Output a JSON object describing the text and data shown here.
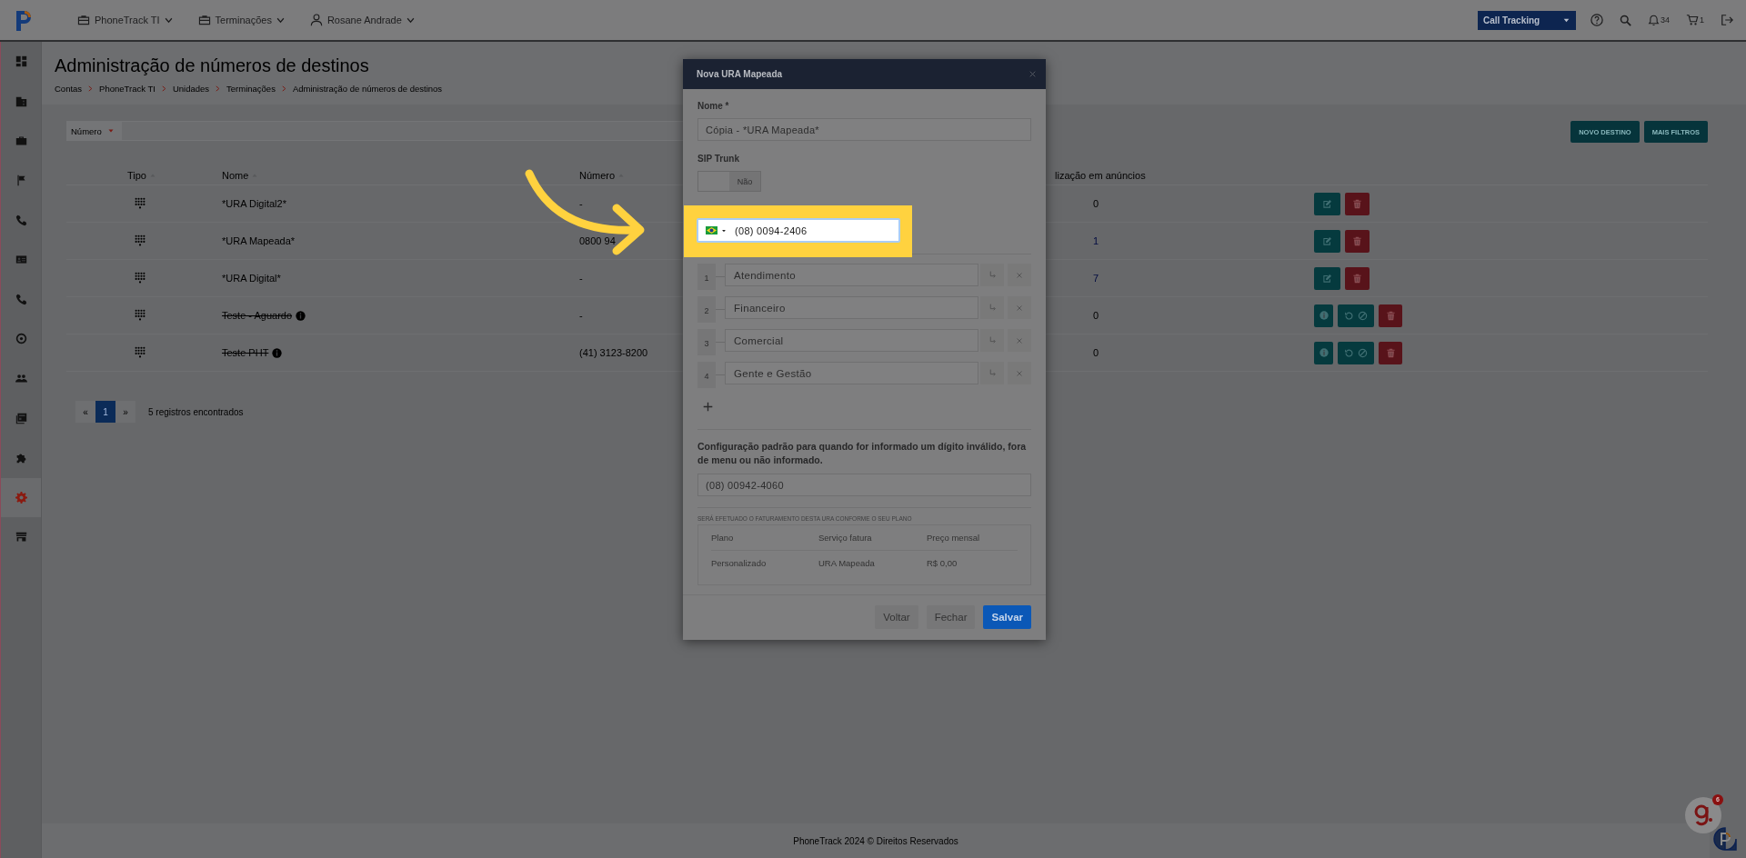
{
  "topbar": {
    "menus": [
      {
        "label": "PhoneTrack TI"
      },
      {
        "label": "Terminações"
      },
      {
        "label": "Rosane Andrade"
      }
    ],
    "product_select": "Call Tracking",
    "notification_count": "34",
    "cart_count": "1"
  },
  "sidebar": {
    "items": [
      {
        "selected": false
      },
      {
        "selected": false
      },
      {
        "selected": false
      },
      {
        "selected": false
      },
      {
        "selected": false
      },
      {
        "selected": false
      },
      {
        "selected": false
      },
      {
        "selected": false
      },
      {
        "selected": false
      },
      {
        "selected": false
      },
      {
        "selected": false
      },
      {
        "selected": true
      },
      {
        "selected": false
      }
    ]
  },
  "page": {
    "title": "Administração de números de destinos",
    "breadcrumb": [
      "Contas",
      "PhoneTrack TI",
      "Unidades",
      "Terminações",
      "Administração de números de destinos"
    ]
  },
  "filter": {
    "field": "Número"
  },
  "toolbar": {
    "buttons": [
      "NOVO DESTINO",
      "MAIS FILTROS"
    ]
  },
  "table": {
    "columns": [
      {
        "label": "Tipo",
        "sortable": true
      },
      {
        "label": "Nome",
        "sortable": true
      },
      {
        "label": "Número",
        "sortable": true
      },
      {
        "label": "lização em anúncios",
        "sortable": false
      }
    ],
    "rows": [
      {
        "name": "*URA Digital2*",
        "removed": false,
        "number": "-",
        "usage": "0",
        "usage_linked": false
      },
      {
        "name": "*URA Mapeada*",
        "removed": false,
        "number": "0800 94",
        "usage": "1",
        "usage_linked": true
      },
      {
        "name": "*URA Digital*",
        "removed": false,
        "number": "-",
        "usage": "7",
        "usage_linked": true
      },
      {
        "name": "Teste - Aguardo",
        "removed": true,
        "number": "-",
        "usage": "0",
        "usage_linked": false
      },
      {
        "name": "Teste PHT",
        "removed": true,
        "number": "(41) 3123-8200",
        "usage": "0",
        "usage_linked": false
      }
    ]
  },
  "pagination": {
    "pages": [
      {
        "label": "«",
        "selected": false
      },
      {
        "label": "1",
        "selected": true
      },
      {
        "label": "»",
        "selected": false
      }
    ],
    "summary": "5 registros encontrados"
  },
  "footer": "PhoneTrack 2024 © Direitos Reservados",
  "chat_widget": {
    "badge": "6"
  },
  "modal": {
    "title": "Nova URA Mapeada",
    "name_label": "Nome *",
    "name_value": "Cópia - *URA Mapeada*",
    "sip_trunk": {
      "label": "SIP Trunk",
      "on": false,
      "state_text": "Não"
    },
    "phone_value": "(08) 0094-2406",
    "options": [
      {
        "digit": "1",
        "label": "Atendimento"
      },
      {
        "digit": "2",
        "label": "Financeiro"
      },
      {
        "digit": "3",
        "label": "Comercial"
      },
      {
        "digit": "4",
        "label": "Gente e Gestão"
      }
    ],
    "default_config_text": "Configuração padrão para quando for informado um dígito inválido, fora de menu ou não informado.",
    "default_config_value": "(08) 00942-4060",
    "billing_note": "SERÁ EFETUADO O FATURAMENTO DESTA URA CONFORME O SEU PLANO",
    "billing_columns": [
      "Plano",
      "Serviço fatura",
      "Preço mensal"
    ],
    "billing_rows": [
      [
        "Personalizado",
        "URA Mapeada",
        "R$ 0,00"
      ]
    ],
    "buttons": [
      {
        "label": "Voltar",
        "kind": "default"
      },
      {
        "label": "Fechar",
        "kind": "default"
      },
      {
        "label": "Salvar",
        "kind": "primary"
      }
    ]
  }
}
